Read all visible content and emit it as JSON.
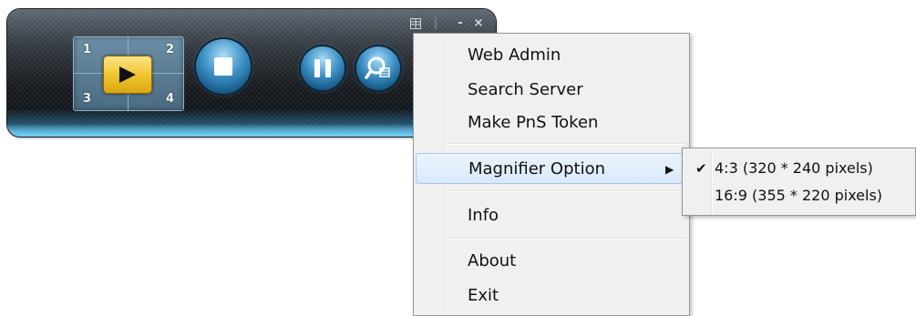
{
  "player": {
    "grid_numbers": [
      "1",
      "2",
      "3",
      "4"
    ],
    "controls": {
      "menu_icon": "menu-grid-icon",
      "separator": "|",
      "minimize": "-",
      "close": "×"
    }
  },
  "menu": {
    "items": [
      {
        "label": "Web Admin"
      },
      {
        "label": "Search Server"
      },
      {
        "label": "Make PnS Token"
      },
      {
        "label": "Magnifier Option",
        "has_submenu": true,
        "highlighted": true
      },
      {
        "label": "Info"
      },
      {
        "label": "About"
      },
      {
        "label": "Exit"
      }
    ],
    "submenu_arrow": "▶"
  },
  "submenu": {
    "items": [
      {
        "label": "4:3  (320 * 240 pixels)",
        "checked": true,
        "check": "✔"
      },
      {
        "label": "16:9 (355 * 220 pixels)",
        "checked": false,
        "check": ""
      }
    ]
  },
  "colors": {
    "accent": "#f1c730",
    "glow": "#5fc3ef",
    "menu_bg": "#f0f0f0",
    "highlight": "#d9e9fb"
  }
}
